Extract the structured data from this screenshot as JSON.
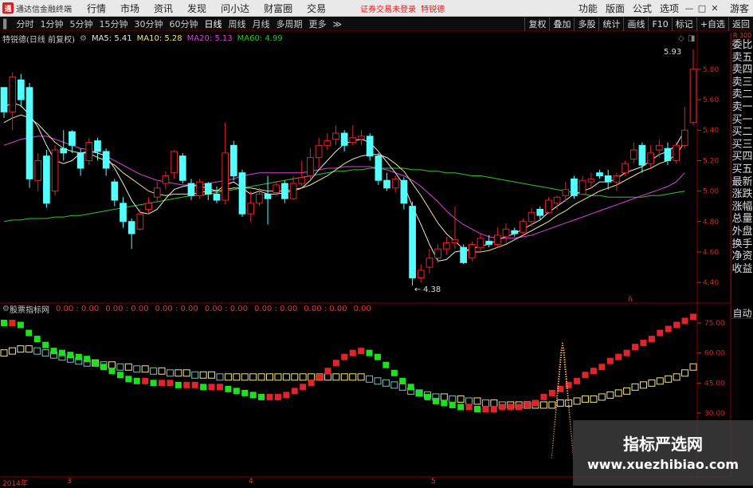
{
  "menubar": {
    "logo_char": "通",
    "app_title": "通达信金融终端",
    "menus": [
      "行情",
      "市场",
      "资讯",
      "发现",
      "问小达",
      "财富圈",
      "交易"
    ],
    "status_text": "证券交易未登录",
    "stock_name": "特锐德",
    "right_items": [
      "功能",
      "版面",
      "公式",
      "选项"
    ],
    "guest": "游客"
  },
  "toolbar": {
    "periods": [
      "分时",
      "1分钟",
      "5分钟",
      "15分钟",
      "30分钟",
      "60分钟",
      "日线",
      "周线",
      "月线",
      "多周期",
      "更多"
    ],
    "right_buttons": [
      "复权",
      "叠加",
      "多股",
      "统计",
      "画线",
      "F10",
      "标记",
      "+自选",
      "返回"
    ]
  },
  "info": {
    "title": "特锐德(日线 前复权)",
    "ma5": "MA5: 5.41",
    "ma10": "MA10: 5.28",
    "ma20": "MA20: 5.13",
    "ma60": "MA60: 4.99"
  },
  "colors": {
    "up": "#e0242a",
    "down": "#54ffff",
    "ma5": "#e8e8e8",
    "ma10": "#f0e68c",
    "ma20": "#e040e0",
    "ma60": "#2fc42f",
    "axis": "#e02020"
  },
  "price_axis": [
    "5.80",
    "5.60",
    "5.40",
    "5.20",
    "5.00",
    "4.80",
    "4.60",
    "4.40"
  ],
  "high_label": "5.93",
  "low_label": "4.38",
  "right_panel": {
    "top": "R 300",
    "items": [
      "委比",
      "卖五",
      "卖四",
      "卖三",
      "卖二",
      "卖一",
      "买一",
      "买二",
      "买三",
      "买四",
      "买五",
      "最新",
      "涨跌",
      "涨幅",
      "总量",
      "外盘",
      "换手",
      "净资",
      "收益"
    ]
  },
  "indicator": {
    "title": "股票指标网",
    "values": [
      "0.00 : 0.00",
      "0.00 : 0.00",
      "0.00 : 0.00",
      "0.00 : 0.00",
      "0.00 : 0.00",
      "0.00 : 0.00",
      "0.00"
    ],
    "axis": [
      "75.00",
      "60.00",
      "45.00",
      "30.00"
    ],
    "auto": "自动"
  },
  "dates": [
    "2014年",
    "3",
    "4",
    "5"
  ],
  "watermark": {
    "title": "指标严选网",
    "url": "www.xuezhibiao.com"
  },
  "chart_data": {
    "type": "candlestick",
    "candles": [
      [
        5.68,
        5.52,
        5.6,
        5.48
      ],
      [
        5.52,
        5.75,
        5.78,
        5.4
      ],
      [
        5.73,
        5.6,
        5.77,
        5.55
      ],
      [
        5.68,
        5.08,
        5.71,
        5.02
      ],
      [
        5.07,
        5.2,
        5.25,
        5.0
      ],
      [
        5.23,
        4.92,
        5.27,
        4.89
      ],
      [
        5.0,
        5.27,
        5.3,
        4.97
      ],
      [
        5.28,
        5.25,
        5.4,
        5.2
      ],
      [
        5.39,
        5.3,
        5.4,
        5.25
      ],
      [
        5.25,
        5.15,
        5.28,
        5.1
      ],
      [
        5.2,
        5.32,
        5.35,
        5.17
      ],
      [
        5.33,
        5.26,
        5.35,
        5.2
      ],
      [
        5.26,
        5.15,
        5.28,
        5.1
      ],
      [
        5.06,
        4.94,
        5.08,
        4.9
      ],
      [
        4.92,
        4.8,
        4.96,
        4.76
      ],
      [
        4.8,
        4.72,
        4.82,
        4.62
      ],
      [
        4.75,
        4.85,
        4.88,
        4.74
      ],
      [
        4.88,
        4.92,
        4.96,
        4.85
      ],
      [
        4.96,
        5.02,
        5.06,
        4.93
      ],
      [
        5.05,
        5.1,
        5.13,
        5.01
      ],
      [
        5.12,
        5.26,
        5.27,
        5.08
      ],
      [
        5.23,
        5.07,
        5.25,
        5.05
      ],
      [
        5.05,
        4.97,
        5.08,
        4.94
      ],
      [
        4.97,
        5.06,
        5.08,
        4.95
      ],
      [
        5.05,
        4.98,
        5.06,
        4.94
      ],
      [
        4.98,
        4.94,
        5.03,
        4.92
      ],
      [
        4.94,
        5.25,
        5.45,
        4.91
      ],
      [
        5.3,
        5.1,
        5.33,
        5.07
      ],
      [
        5.12,
        4.85,
        5.14,
        4.83
      ],
      [
        4.85,
        4.92,
        5.0,
        4.8
      ],
      [
        4.92,
        4.98,
        5.02,
        4.9
      ],
      [
        4.98,
        4.95,
        5.1,
        4.78
      ],
      [
        4.99,
        5.04,
        5.06,
        4.97
      ],
      [
        5.05,
        4.95,
        5.07,
        4.92
      ],
      [
        4.95,
        5.05,
        5.1,
        4.94
      ],
      [
        5.05,
        5.09,
        5.2,
        5.03
      ],
      [
        5.1,
        5.22,
        5.28,
        5.08
      ],
      [
        5.22,
        5.3,
        5.35,
        5.15
      ],
      [
        5.3,
        5.33,
        5.38,
        5.27
      ],
      [
        5.34,
        5.38,
        5.43,
        5.3
      ],
      [
        5.38,
        5.3,
        5.4,
        5.26
      ],
      [
        5.32,
        5.35,
        5.43,
        5.3
      ],
      [
        5.34,
        5.36,
        5.4,
        5.3
      ],
      [
        5.36,
        5.23,
        5.38,
        5.2
      ],
      [
        5.23,
        5.07,
        5.25,
        5.04
      ],
      [
        5.07,
        5.02,
        5.12,
        5.0
      ],
      [
        5.02,
        5.08,
        5.1,
        4.99
      ],
      [
        5.07,
        4.92,
        5.09,
        4.88
      ],
      [
        4.9,
        4.43,
        4.93,
        4.38
      ],
      [
        4.43,
        4.48,
        4.52,
        4.4
      ],
      [
        4.5,
        4.56,
        4.62,
        4.46
      ],
      [
        4.56,
        4.62,
        4.65,
        4.53
      ],
      [
        4.62,
        4.66,
        4.7,
        4.58
      ],
      [
        4.66,
        4.68,
        4.9,
        4.62
      ],
      [
        4.63,
        4.53,
        4.65,
        4.52
      ],
      [
        4.56,
        4.65,
        4.67,
        4.54
      ],
      [
        4.63,
        4.69,
        4.72,
        4.6
      ],
      [
        4.67,
        4.65,
        4.71,
        4.63
      ],
      [
        4.65,
        4.71,
        4.76,
        4.63
      ],
      [
        4.7,
        4.75,
        4.79,
        4.66
      ],
      [
        4.74,
        4.72,
        4.76,
        4.7
      ],
      [
        4.73,
        4.8,
        4.82,
        4.71
      ],
      [
        4.8,
        4.86,
        4.89,
        4.77
      ],
      [
        4.88,
        4.84,
        4.9,
        4.81
      ],
      [
        4.86,
        4.94,
        4.96,
        4.85
      ],
      [
        4.92,
        4.96,
        4.97,
        4.88
      ],
      [
        4.97,
        5.01,
        5.06,
        4.93
      ],
      [
        5.08,
        4.97,
        5.1,
        4.95
      ],
      [
        4.98,
        5.07,
        5.1,
        4.97
      ],
      [
        5.06,
        5.08,
        5.12,
        5.02
      ],
      [
        5.12,
        5.1,
        5.14,
        5.08
      ],
      [
        5.1,
        5.06,
        5.14,
        5.01
      ],
      [
        5.06,
        5.1,
        5.12,
        5.0
      ],
      [
        5.12,
        5.18,
        5.2,
        5.1
      ],
      [
        5.21,
        5.27,
        5.32,
        5.18
      ],
      [
        5.3,
        5.17,
        5.32,
        5.12
      ],
      [
        5.18,
        5.25,
        5.3,
        5.15
      ],
      [
        5.27,
        5.3,
        5.34,
        5.22
      ],
      [
        5.28,
        5.2,
        5.32,
        5.17
      ],
      [
        5.2,
        5.3,
        5.32,
        5.18
      ],
      [
        5.3,
        5.4,
        5.55,
        5.28
      ],
      [
        5.45,
        5.8,
        5.93,
        5.43
      ]
    ],
    "ma5": [
      5.55,
      5.58,
      5.56,
      5.5,
      5.42,
      5.3,
      5.2,
      5.18,
      5.2,
      5.25,
      5.26,
      5.25,
      5.23,
      5.15,
      5.05,
      4.94,
      4.86,
      4.85,
      4.88,
      4.95,
      5.01,
      5.03,
      5.04,
      5.03,
      5.02,
      5.0,
      5.04,
      5.06,
      5.02,
      4.98,
      5.0,
      4.98,
      4.98,
      4.99,
      5.0,
      5.02,
      5.07,
      5.14,
      5.2,
      5.26,
      5.31,
      5.33,
      5.34,
      5.32,
      5.26,
      5.19,
      5.12,
      5.04,
      4.9,
      4.78,
      4.65,
      4.54,
      4.55,
      4.6,
      4.61,
      4.62,
      4.64,
      4.65,
      4.68,
      4.7,
      4.72,
      4.75,
      4.78,
      4.81,
      4.86,
      4.9,
      4.94,
      4.98,
      5.0,
      5.02,
      5.06,
      5.06,
      5.08,
      5.12,
      5.14,
      5.16,
      5.2,
      5.24,
      5.26,
      5.3,
      5.4
    ],
    "ma10": [
      5.45,
      5.48,
      5.5,
      5.48,
      5.44,
      5.38,
      5.32,
      5.28,
      5.26,
      5.25,
      5.25,
      5.22,
      5.2,
      5.17,
      5.12,
      5.08,
      5.04,
      5.0,
      4.98,
      4.97,
      4.98,
      4.98,
      4.98,
      4.99,
      5.0,
      5.0,
      5.01,
      5.02,
      5.02,
      5.02,
      5.01,
      5.0,
      5.0,
      5.0,
      5.01,
      5.02,
      5.04,
      5.07,
      5.1,
      5.14,
      5.18,
      5.21,
      5.23,
      5.24,
      5.24,
      5.22,
      5.18,
      5.13,
      5.05,
      4.97,
      4.88,
      4.79,
      4.72,
      4.67,
      4.62,
      4.6,
      4.6,
      4.61,
      4.63,
      4.65,
      4.68,
      4.71,
      4.74,
      4.77,
      4.8,
      4.84,
      4.87,
      4.91,
      4.94,
      4.97,
      5.0,
      5.02,
      5.04,
      5.07,
      5.1,
      5.13,
      5.15,
      5.18,
      5.2,
      5.24,
      5.32
    ],
    "ma20": [
      5.3,
      5.32,
      5.34,
      5.35,
      5.36,
      5.36,
      5.34,
      5.32,
      5.3,
      5.28,
      5.27,
      5.25,
      5.23,
      5.2,
      5.17,
      5.14,
      5.11,
      5.09,
      5.07,
      5.06,
      5.05,
      5.04,
      5.04,
      5.04,
      5.05,
      5.06,
      5.07,
      5.08,
      5.1,
      5.11,
      5.12,
      5.12,
      5.12,
      5.12,
      5.12,
      5.12,
      5.13,
      5.14,
      5.15,
      5.15,
      5.16,
      5.16,
      5.16,
      5.16,
      5.15,
      5.14,
      5.12,
      5.1,
      5.07,
      5.03,
      4.98,
      4.93,
      4.87,
      4.82,
      4.78,
      4.75,
      4.72,
      4.7,
      4.69,
      4.69,
      4.69,
      4.7,
      4.71,
      4.73,
      4.75,
      4.77,
      4.79,
      4.81,
      4.83,
      4.85,
      4.87,
      4.89,
      4.91,
      4.93,
      4.95,
      4.97,
      4.99,
      5.01,
      5.03,
      5.06,
      5.12
    ],
    "ma60": [
      4.8,
      4.81,
      4.81,
      4.82,
      4.82,
      4.82,
      4.83,
      4.83,
      4.84,
      4.84,
      4.85,
      4.86,
      4.87,
      4.88,
      4.89,
      4.9,
      4.91,
      4.92,
      4.93,
      4.94,
      4.95,
      4.96,
      4.97,
      4.97,
      4.98,
      4.99,
      5.0,
      5.01,
      5.02,
      5.03,
      5.04,
      5.05,
      5.06,
      5.07,
      5.08,
      5.09,
      5.1,
      5.11,
      5.12,
      5.13,
      5.13,
      5.14,
      5.14,
      5.15,
      5.15,
      5.15,
      5.15,
      5.15,
      5.14,
      5.14,
      5.13,
      5.13,
      5.12,
      5.12,
      5.11,
      5.1,
      5.1,
      5.09,
      5.08,
      5.07,
      5.06,
      5.05,
      5.04,
      5.03,
      5.02,
      5.01,
      5.0,
      4.99,
      4.98,
      4.97,
      4.97,
      4.96,
      4.96,
      4.96,
      4.96,
      4.96,
      4.97,
      4.97,
      4.98,
      4.99,
      5.0
    ],
    "indicator_main": [
      75,
      75,
      74,
      70,
      67,
      64,
      61,
      60,
      59,
      58,
      57,
      55,
      53,
      51,
      49,
      47,
      46,
      46,
      45,
      45,
      45,
      44,
      44,
      44,
      43,
      43,
      43,
      42,
      41,
      40,
      39,
      38,
      38,
      38,
      39,
      41,
      43,
      45,
      48,
      51,
      55,
      58,
      60,
      61,
      60,
      58,
      54,
      50,
      46,
      43,
      40,
      38,
      36,
      35,
      34,
      33,
      33,
      32,
      32,
      32,
      33,
      33,
      33,
      34,
      35,
      38,
      40,
      42,
      44,
      46,
      49,
      51,
      53,
      56,
      58,
      60,
      63,
      65,
      67,
      70,
      72,
      74,
      76,
      78
    ],
    "indicator_signal": [
      60,
      61,
      62,
      62,
      61,
      60,
      59,
      58,
      57,
      56,
      55,
      55,
      54,
      54,
      53,
      53,
      52,
      52,
      51,
      51,
      50,
      50,
      50,
      49,
      49,
      49,
      48,
      48,
      48,
      48,
      48,
      48,
      48,
      48,
      48,
      48,
      48,
      48,
      48,
      48,
      48,
      48,
      48,
      48,
      47,
      46,
      45,
      44,
      43,
      41,
      40,
      39,
      38,
      38,
      37,
      37,
      36,
      36,
      35,
      35,
      34,
      34,
      34,
      34,
      34,
      34,
      34,
      35,
      35,
      36,
      37,
      37,
      38,
      39,
      40,
      41,
      43,
      44,
      45,
      46,
      47,
      48,
      50,
      53
    ]
  }
}
